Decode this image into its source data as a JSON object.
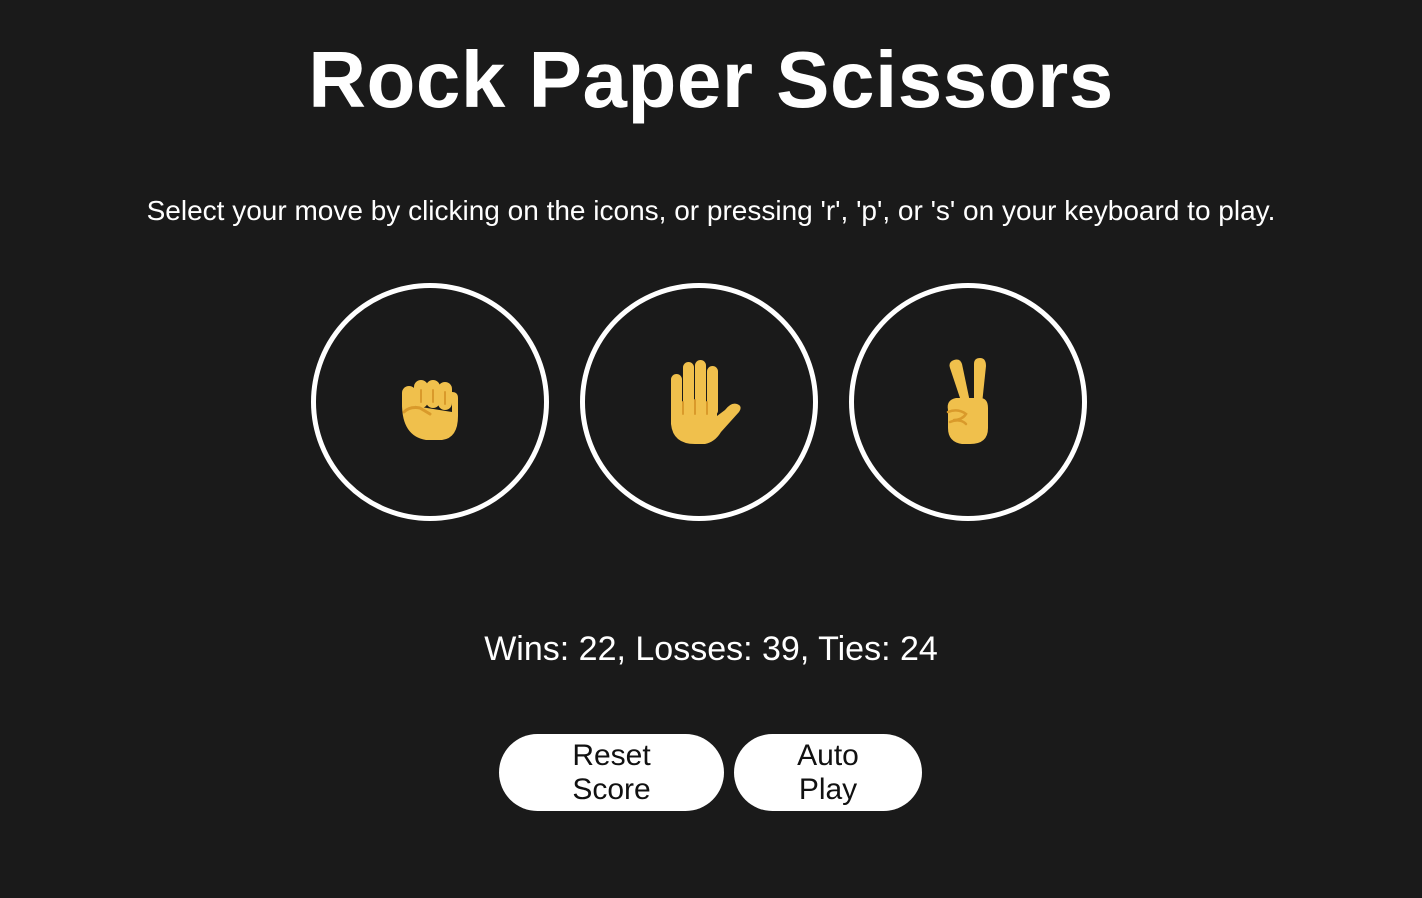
{
  "title": "Rock Paper Scissors",
  "instructions": "Select your move by clicking on the icons, or pressing 'r', 'p', or 's' on your keyboard to play.",
  "moves": [
    {
      "name": "rock",
      "icon": "raised-fist-icon"
    },
    {
      "name": "paper",
      "icon": "raised-hand-icon"
    },
    {
      "name": "scissors",
      "icon": "victory-hand-icon"
    }
  ],
  "score_text": "Wins: 22, Losses: 39, Ties: 24",
  "score": {
    "wins": 22,
    "losses": 39,
    "ties": 24
  },
  "buttons": {
    "reset": "Reset Score",
    "auto_play": "Auto Play"
  },
  "colors": {
    "background": "#1a1a1a",
    "text": "#ffffff",
    "hand_fill": "#f0c04c",
    "hand_line": "#d99a2b"
  }
}
